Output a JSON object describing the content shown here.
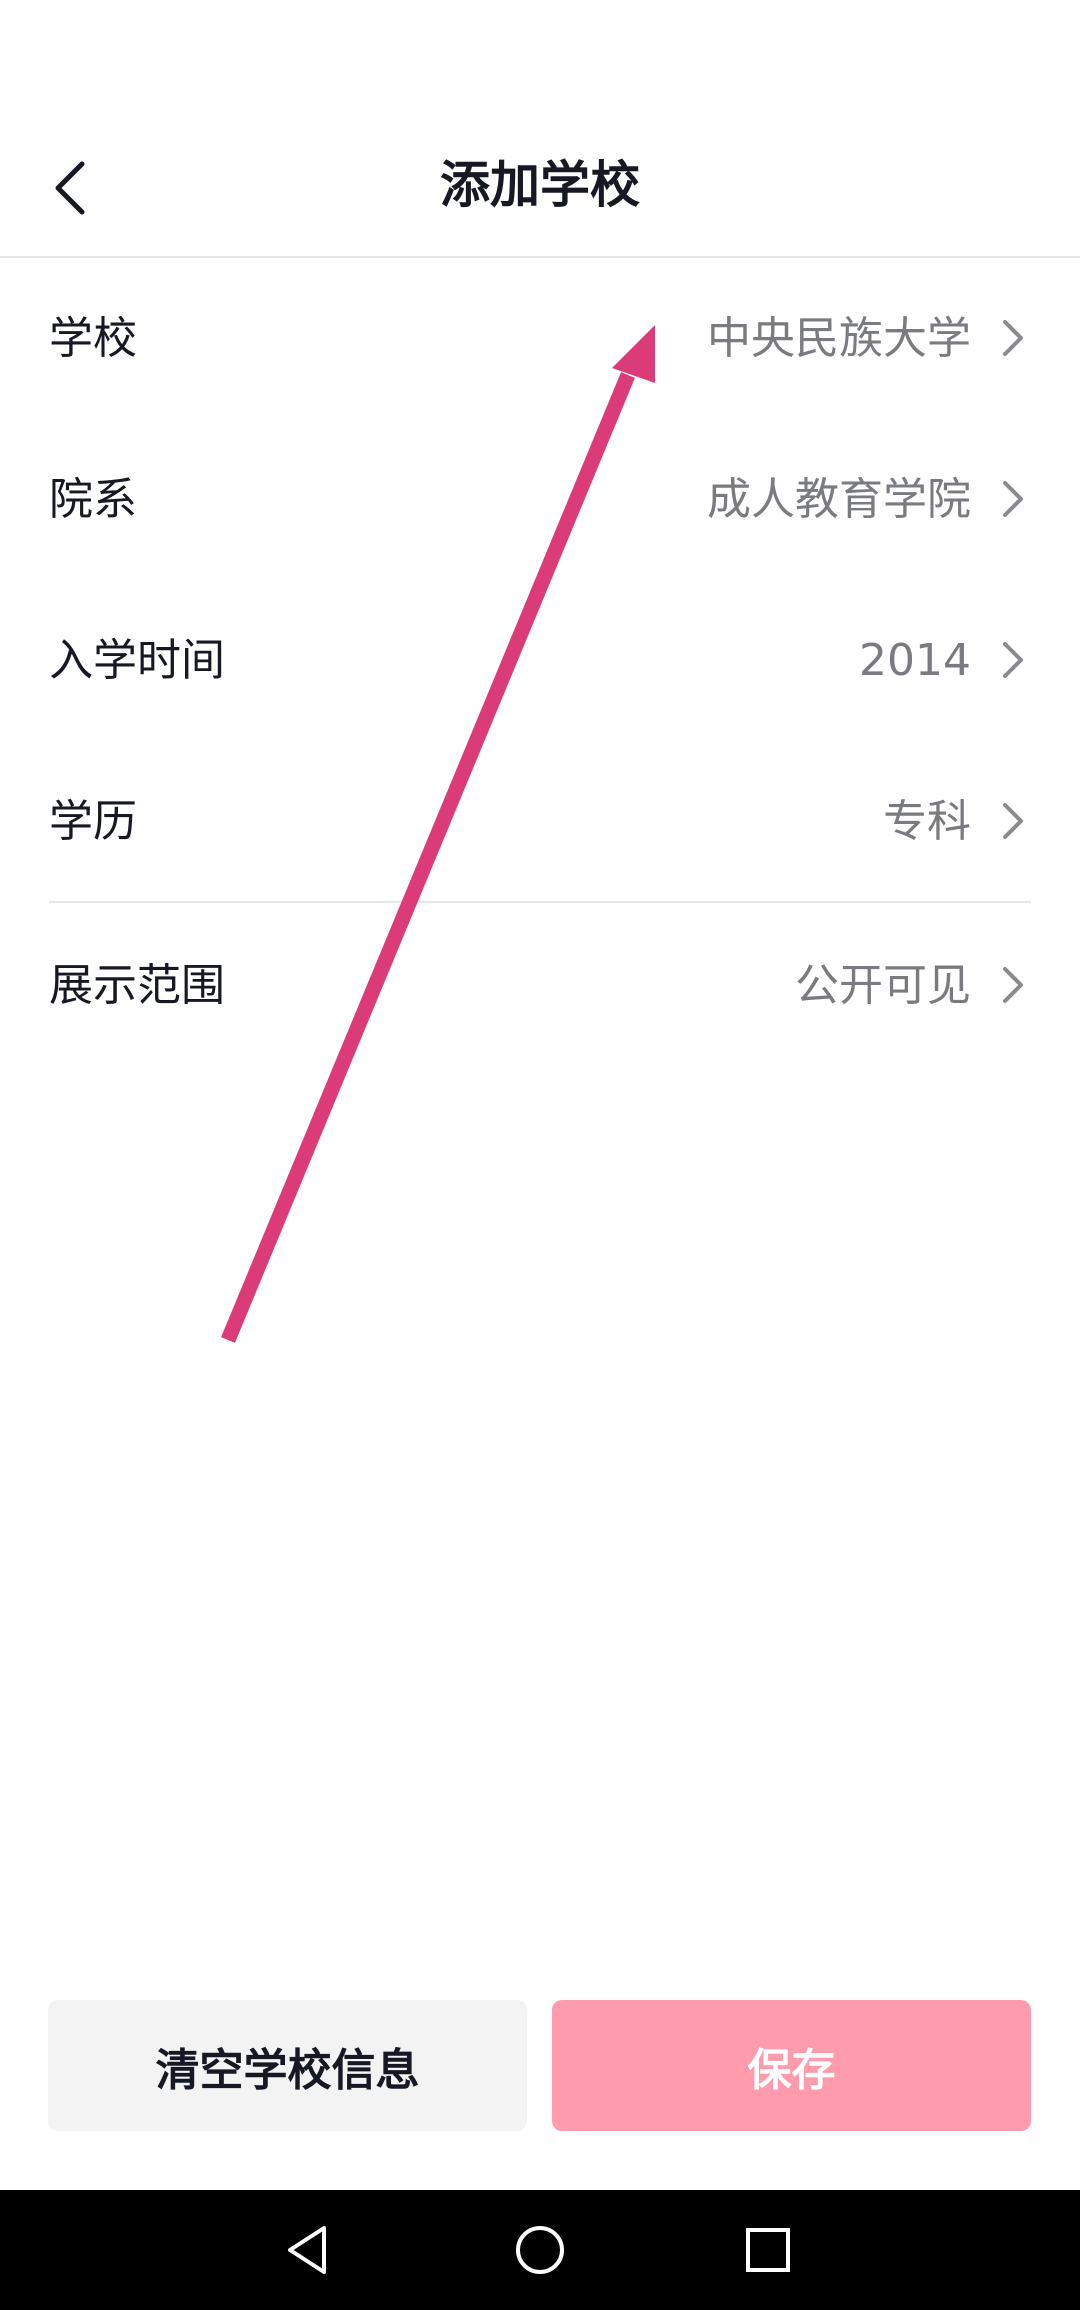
{
  "header": {
    "title": "添加学校",
    "back_icon": "chevron-left-icon"
  },
  "rows": [
    {
      "label": "学校",
      "value": "中央民族大学"
    },
    {
      "label": "院系",
      "value": "成人教育学院"
    },
    {
      "label": "入学时间",
      "value": "2014"
    },
    {
      "label": "学历",
      "value": "专科"
    },
    {
      "label": "展示范围",
      "value": "公开可见"
    }
  ],
  "buttons": {
    "clear_label": "清空学校信息",
    "save_label": "保存"
  },
  "nav": {
    "back_icon": "triangle-back-icon",
    "home_icon": "circle-home-icon",
    "recents_icon": "square-recents-icon"
  },
  "colors": {
    "accent": "#fe2c55",
    "save_button_disabled": "#fe9bac",
    "annotation_arrow": "#dc3b7a",
    "value_text": "#7a7b80"
  }
}
